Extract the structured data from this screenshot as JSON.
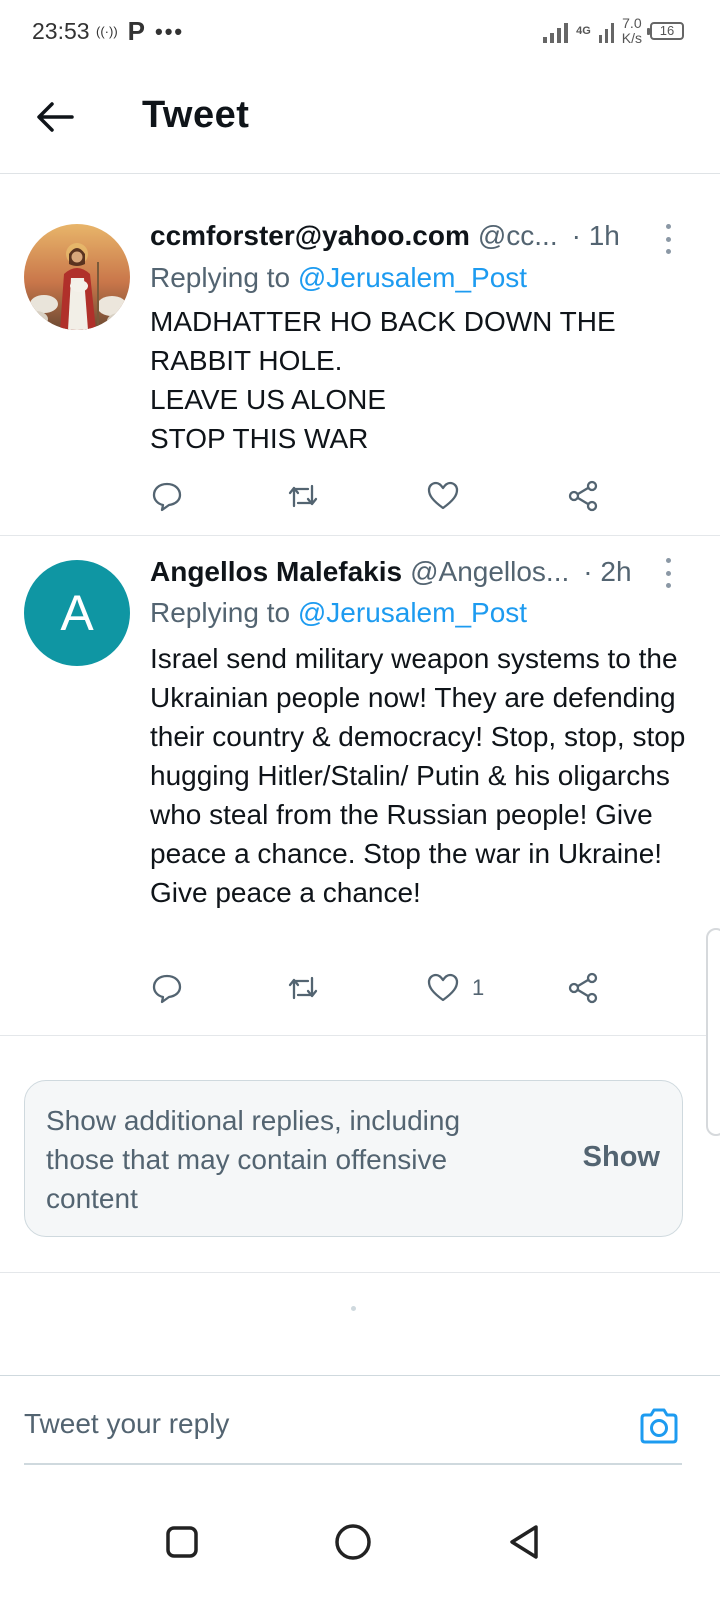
{
  "status_bar": {
    "time": "23:53",
    "left_icons": [
      "hotspot-icon",
      "p-icon",
      "more-dots-icon"
    ],
    "network_type": "4G",
    "speed_value": "7.0",
    "speed_unit": "K/s",
    "battery": "16"
  },
  "header": {
    "title": "Tweet",
    "back_icon": "arrow-left-icon"
  },
  "tweets": [
    {
      "name": "ccmforster@yahoo.com",
      "handle": "@cc...",
      "time": "· 1h",
      "reply_prefix": "Replying to ",
      "reply_mention": "@Jerusalem_Post",
      "text": "MADHATTER HO BACK DOWN THE\nRABBIT HOLE.\nLEAVE US ALONE\nSTOP THIS WAR",
      "like_count": ""
    },
    {
      "name": "Angellos Malefakis",
      "handle": "@Angellos...",
      "time": "· 2h",
      "avatar_letter": "A",
      "avatar_color": "#0f96a3",
      "reply_prefix": "Replying to ",
      "reply_mention": "@Jerusalem_Post",
      "text": "Israel send military weapon systems to the Ukrainian people now!  They are defending their country & democracy! Stop, stop, stop hugging Hitler/Stalin/ Putin & his oligarchs who steal from the Russian people! Give peace a chance. Stop the war in Ukraine! Give peace a chance!",
      "like_count": "1"
    }
  ],
  "show_more": {
    "text": "Show additional replies, including those that may contain offensive content",
    "button": "Show"
  },
  "composer": {
    "placeholder": "Tweet your reply",
    "camera_icon": "camera-icon"
  },
  "nav": {
    "icons": [
      "recents-square-icon",
      "home-circle-icon",
      "back-triangle-icon"
    ]
  },
  "colors": {
    "link": "#1d9bf0",
    "secondary_text": "#536471",
    "avatar_teal": "#0f96a3"
  }
}
